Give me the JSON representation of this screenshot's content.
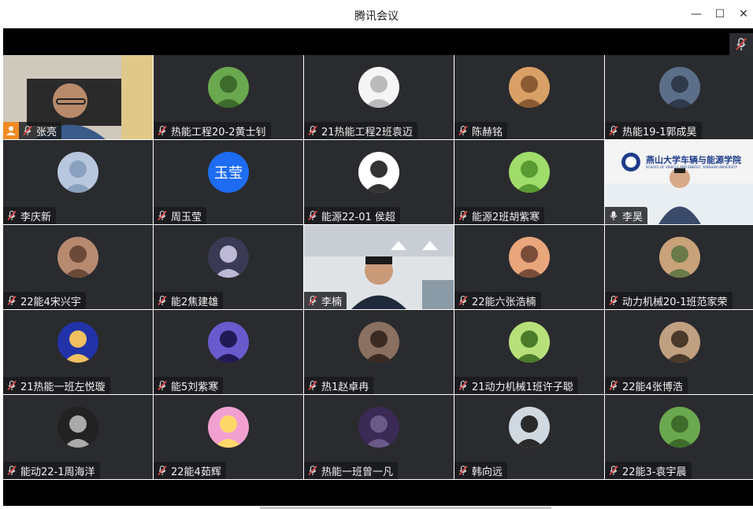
{
  "window": {
    "title": "腾讯会议",
    "controls": [
      "—",
      "☐",
      "✕"
    ]
  },
  "participants": [
    {
      "name": "张亮",
      "video": true,
      "host": true
    },
    {
      "name": "热能工程20-2黄士钊"
    },
    {
      "name": "21热能工程2班袁迈"
    },
    {
      "name": "陈赫铭"
    },
    {
      "name": "热能19-1郭成昊"
    },
    {
      "name": "李庆新"
    },
    {
      "name": "周玉莹",
      "avatar_text": "玉莹"
    },
    {
      "name": "能源22-01 侯超"
    },
    {
      "name": "能源2班胡紫寒"
    },
    {
      "name": "李昊",
      "video": true,
      "mic_on": true,
      "banner": "燕山大学车辆与能源学院",
      "banner_sub": "SCHOOL OF VEHICLE AND ENERGY, YANSHAN UNIVERSITY"
    },
    {
      "name": "22能4宋兴宇"
    },
    {
      "name": "能2焦建雄"
    },
    {
      "name": "李楠",
      "video": true
    },
    {
      "name": "22能六张浩楠"
    },
    {
      "name": "动力机械20-1班范家荣"
    },
    {
      "name": "21热能一班左悦璇"
    },
    {
      "name": "能5刘紫寒"
    },
    {
      "name": "热1赵卓冉"
    },
    {
      "name": "21动力机械1班许子聪"
    },
    {
      "name": "22能4张博浩"
    },
    {
      "name": "能动22-1周海洋"
    },
    {
      "name": "22能4茹辉"
    },
    {
      "name": "热能一班曾一凡"
    },
    {
      "name": "韩向远"
    },
    {
      "name": "22能3-袁宇晨"
    }
  ],
  "colors": {
    "tile_bg": "#2a2b2e",
    "host_badge": "#f08a24",
    "mic_muted": "#e04848",
    "text_avatar_bg": "#1d6cf2"
  }
}
